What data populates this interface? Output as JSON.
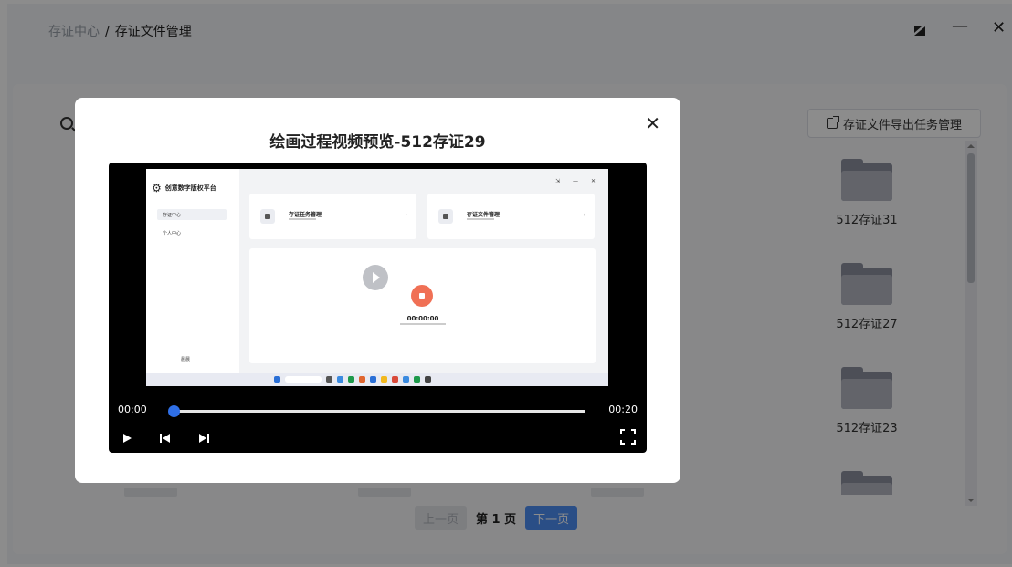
{
  "breadcrumb": {
    "parent": "存证中心",
    "separator": "/",
    "current": "存证文件管理"
  },
  "window": {
    "restore_icon": "restore-icon",
    "minimize_glyph": "—",
    "close_glyph": "✕"
  },
  "toolbar": {
    "export_label": "存证文件导出任务管理"
  },
  "files": [
    {
      "name": "512存证31"
    },
    {
      "name": "512存证27"
    },
    {
      "name": "512存证23"
    },
    {
      "name": ""
    }
  ],
  "pagination": {
    "prev_label": "上一页",
    "page_info": "第 1 页",
    "next_label": "下一页"
  },
  "modal": {
    "title": "绘画过程视频预览-512存证29",
    "close_glyph": "✕"
  },
  "player": {
    "current_time": "00:00",
    "total_time": "00:20",
    "progress": 0
  },
  "video_frame": {
    "app_name": "创意数字版权平台",
    "nav": [
      "存证中心",
      "个人中心"
    ],
    "cards": [
      "存证任务管理",
      "存证文件管理"
    ],
    "timer": "00:00:00",
    "user": "晨晨",
    "window_controls": "⇲ — ✕"
  },
  "colors": {
    "accent": "#4d8ef5",
    "record": "#f07055",
    "progress": "#2f6fe6"
  }
}
